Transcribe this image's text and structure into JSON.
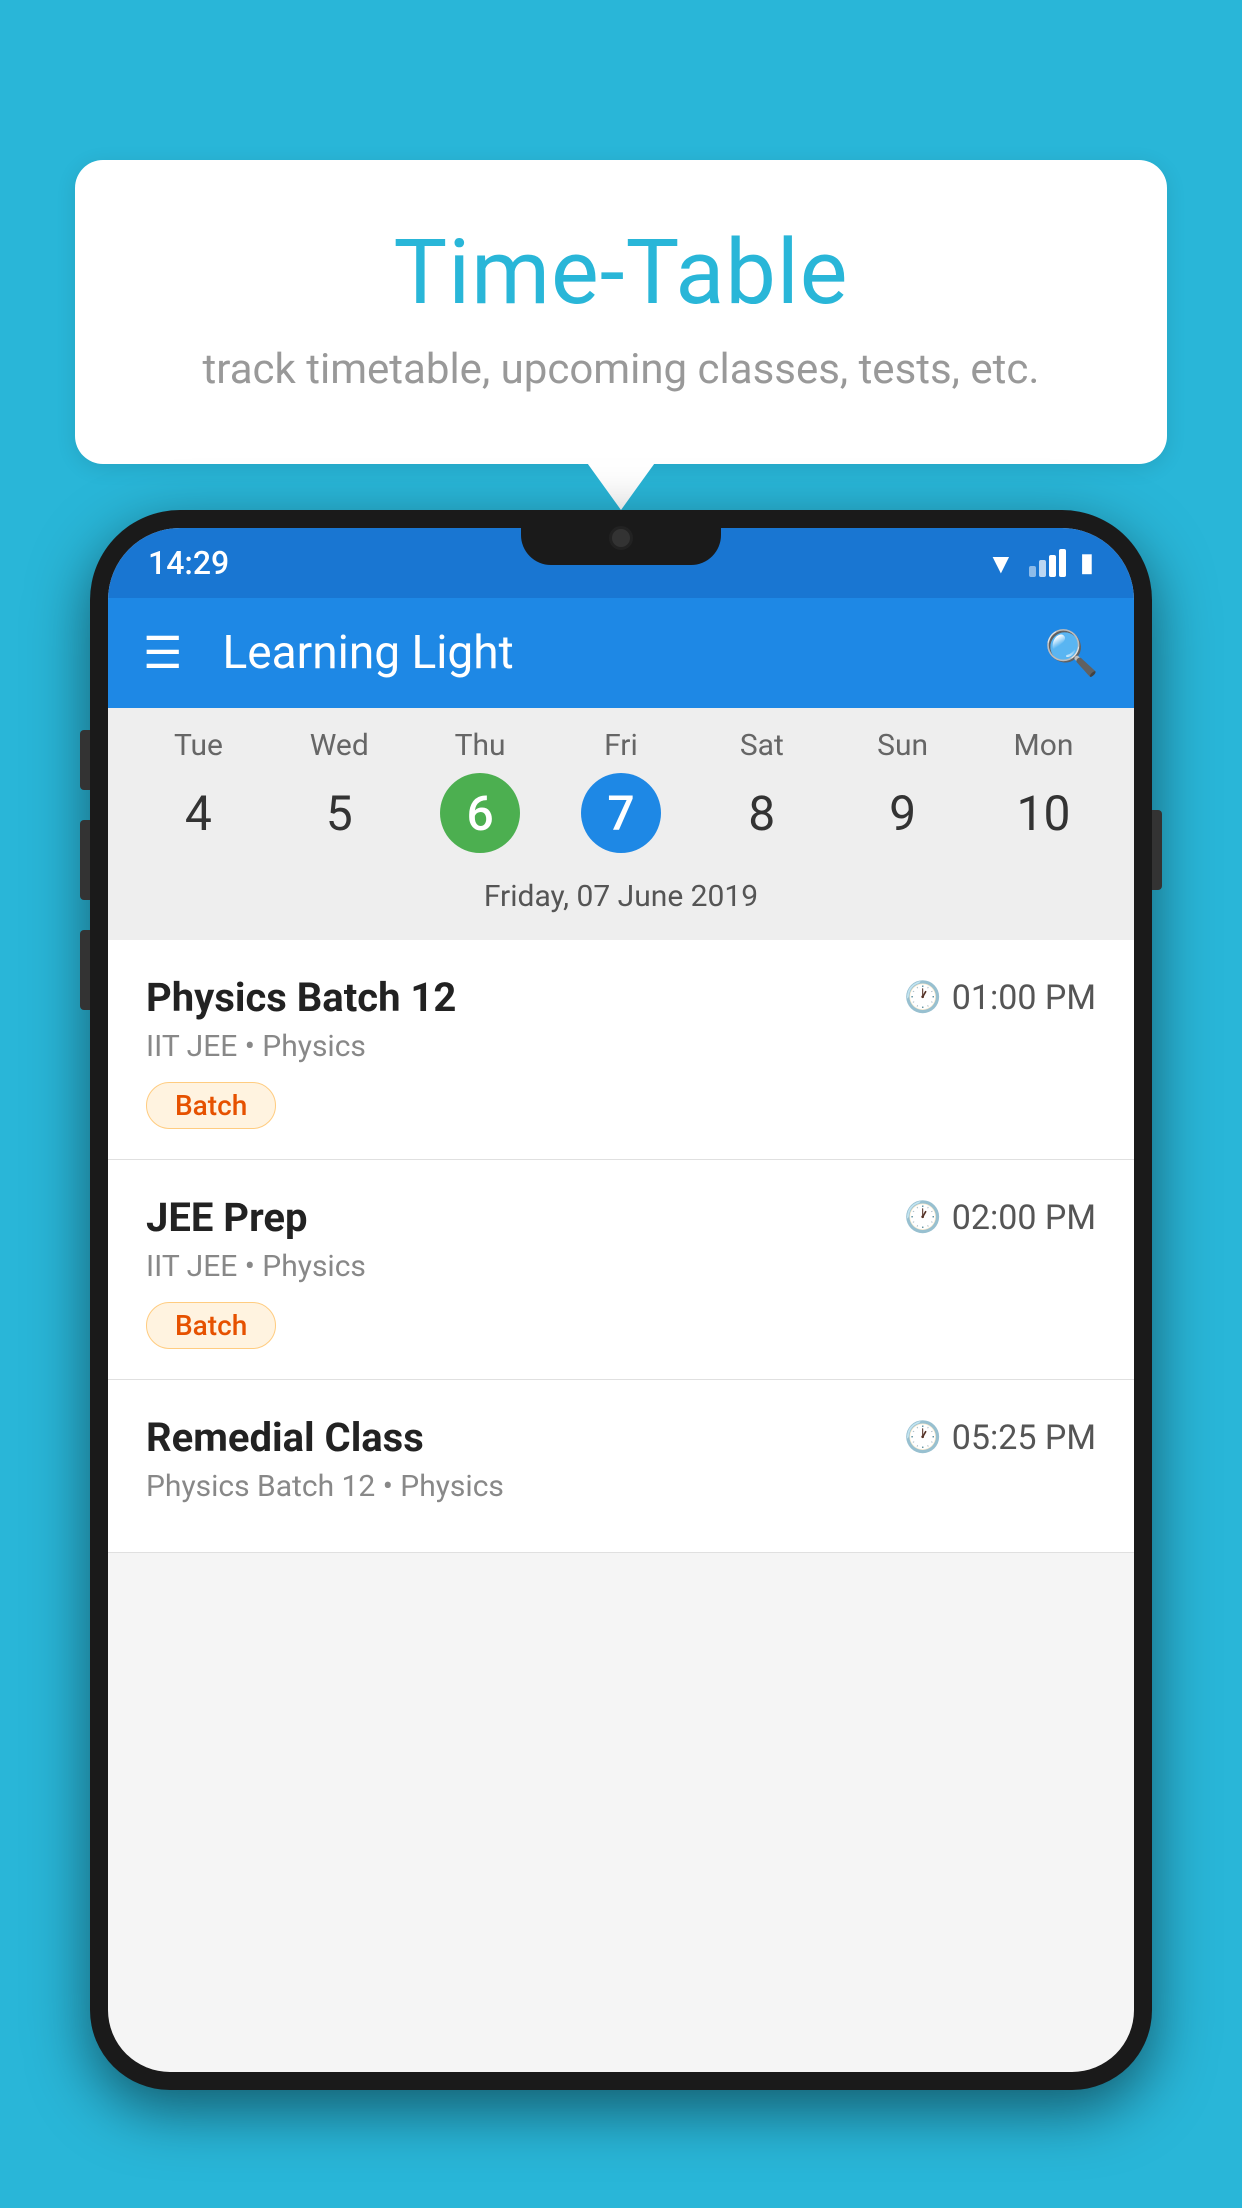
{
  "background_color": "#29B6D8",
  "bubble": {
    "title": "Time-Table",
    "subtitle": "track timetable, upcoming classes, tests, etc."
  },
  "app_bar": {
    "title": "Learning Light",
    "hamburger_icon": "☰",
    "search_icon": "🔍"
  },
  "status_bar": {
    "time": "14:29"
  },
  "calendar": {
    "selected_date_label": "Friday, 07 June 2019",
    "days": [
      {
        "name": "Tue",
        "num": "4",
        "state": "normal"
      },
      {
        "name": "Wed",
        "num": "5",
        "state": "normal"
      },
      {
        "name": "Thu",
        "num": "6",
        "state": "today"
      },
      {
        "name": "Fri",
        "num": "7",
        "state": "selected"
      },
      {
        "name": "Sat",
        "num": "8",
        "state": "normal"
      },
      {
        "name": "Sun",
        "num": "9",
        "state": "normal"
      },
      {
        "name": "Mon",
        "num": "10",
        "state": "normal"
      }
    ]
  },
  "classes": [
    {
      "name": "Physics Batch 12",
      "time": "01:00 PM",
      "meta": "IIT JEE • Physics",
      "tag": "Batch"
    },
    {
      "name": "JEE Prep",
      "time": "02:00 PM",
      "meta": "IIT JEE • Physics",
      "tag": "Batch"
    },
    {
      "name": "Remedial Class",
      "time": "05:25 PM",
      "meta": "Physics Batch 12 • Physics",
      "tag": ""
    }
  ]
}
